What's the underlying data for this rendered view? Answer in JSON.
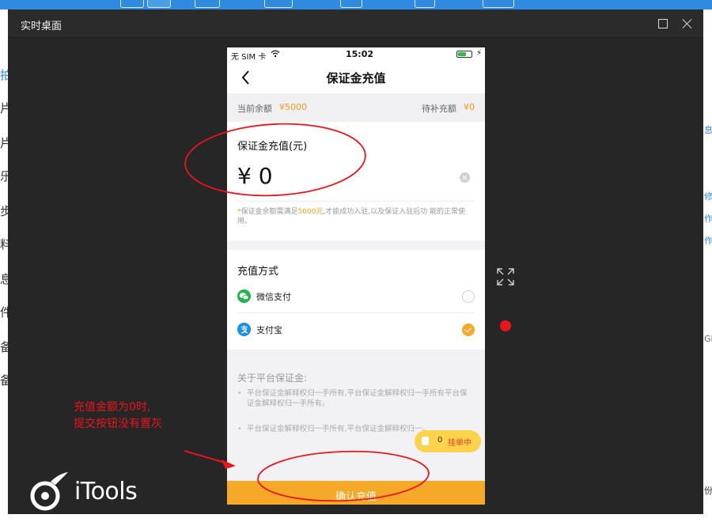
{
  "window": {
    "title": "实时桌面"
  },
  "background_app": {
    "left_fragments": [
      "拍",
      "片",
      "片",
      "乐",
      "步",
      "料",
      "息",
      "件",
      "备",
      "备"
    ],
    "right_fragments": [
      "息",
      "修",
      "作",
      "作",
      "GB",
      "份"
    ]
  },
  "phone": {
    "status_bar": {
      "carrier": "无 SIM 卡",
      "time": "15:02"
    },
    "nav": {
      "title": "保证金充值"
    },
    "balance": {
      "current_label": "当前余额",
      "current_value": "¥5000",
      "pending_label": "待补充额",
      "pending_value": "¥0"
    },
    "amount": {
      "title": "保证金充值(元)",
      "value": "¥ 0",
      "note_star": "*",
      "note_part1": "保证金余额需满足",
      "note_amount": "5000元",
      "note_part2": ",才能成功入驻,以及保证入驻后功 能的正常使用。"
    },
    "payment": {
      "title": "充值方式",
      "methods": [
        {
          "label": "微信支付",
          "selected": false
        },
        {
          "label": "支付宝",
          "selected": true
        }
      ]
    },
    "about": {
      "title": "关于平台保证金:",
      "items": [
        "平台保证金解释权归一手所有,平台保证金解释权归一手所有平台保证金解释权归一手所有。",
        "平台保证金解释权归一手所有,平台保证金解释权归一。"
      ]
    },
    "pending_badge": {
      "count": "0",
      "label": "挂单中"
    },
    "confirm_label": "确认充值"
  },
  "annotation": {
    "line1": "充值金额为0时,",
    "line2": "提交按钮没有置灰"
  },
  "brand": {
    "name": "iTools"
  },
  "colors": {
    "accent": "#f6a828",
    "annotation_red": "#e8151b",
    "window_bg": "#262626"
  }
}
